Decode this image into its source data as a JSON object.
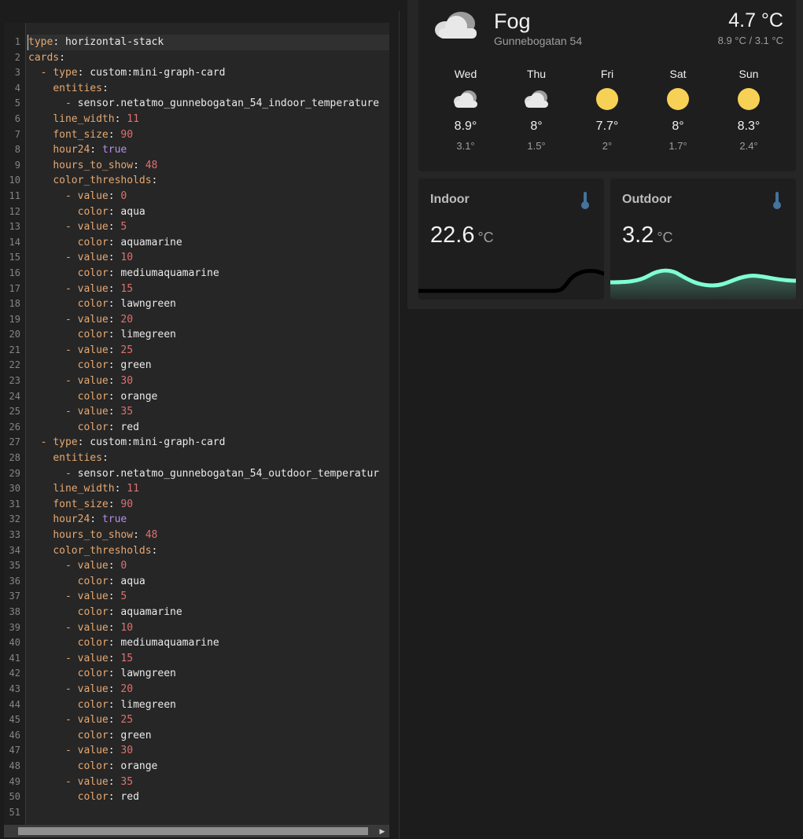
{
  "editor": {
    "lines": [
      [
        [
          "k",
          "type"
        ],
        [
          "s",
          ": "
        ],
        [
          "s",
          "horizontal-stack"
        ]
      ],
      [
        [
          "k",
          "cards"
        ],
        [
          "s",
          ":"
        ]
      ],
      [
        [
          "s",
          "  "
        ],
        [
          "d",
          "- "
        ],
        [
          "k",
          "type"
        ],
        [
          "s",
          ": custom:mini-graph-card"
        ]
      ],
      [
        [
          "s",
          "    "
        ],
        [
          "k",
          "entities"
        ],
        [
          "s",
          ":"
        ]
      ],
      [
        [
          "s",
          "      "
        ],
        [
          "d",
          "- "
        ],
        [
          "s",
          "sensor.netatmo_gunnebogatan_54_indoor_temperature"
        ]
      ],
      [
        [
          "s",
          "    "
        ],
        [
          "k",
          "line_width"
        ],
        [
          "s",
          ": "
        ],
        [
          "n",
          "11"
        ]
      ],
      [
        [
          "s",
          "    "
        ],
        [
          "k",
          "font_size"
        ],
        [
          "s",
          ": "
        ],
        [
          "n",
          "90"
        ]
      ],
      [
        [
          "s",
          "    "
        ],
        [
          "k",
          "hour24"
        ],
        [
          "s",
          ": "
        ],
        [
          "b",
          "true"
        ]
      ],
      [
        [
          "s",
          "    "
        ],
        [
          "k",
          "hours_to_show"
        ],
        [
          "s",
          ": "
        ],
        [
          "n",
          "48"
        ]
      ],
      [
        [
          "s",
          "    "
        ],
        [
          "k",
          "color_thresholds"
        ],
        [
          "s",
          ":"
        ]
      ],
      [
        [
          "s",
          "      "
        ],
        [
          "d",
          "- "
        ],
        [
          "k",
          "value"
        ],
        [
          "s",
          ": "
        ],
        [
          "n",
          "0"
        ]
      ],
      [
        [
          "s",
          "        "
        ],
        [
          "k",
          "color"
        ],
        [
          "s",
          ": aqua"
        ]
      ],
      [
        [
          "s",
          "      "
        ],
        [
          "d",
          "- "
        ],
        [
          "k",
          "value"
        ],
        [
          "s",
          ": "
        ],
        [
          "n",
          "5"
        ]
      ],
      [
        [
          "s",
          "        "
        ],
        [
          "k",
          "color"
        ],
        [
          "s",
          ": aquamarine"
        ]
      ],
      [
        [
          "s",
          "      "
        ],
        [
          "d",
          "- "
        ],
        [
          "k",
          "value"
        ],
        [
          "s",
          ": "
        ],
        [
          "n",
          "10"
        ]
      ],
      [
        [
          "s",
          "        "
        ],
        [
          "k",
          "color"
        ],
        [
          "s",
          ": mediumaquamarine"
        ]
      ],
      [
        [
          "s",
          "      "
        ],
        [
          "d",
          "- "
        ],
        [
          "k",
          "value"
        ],
        [
          "s",
          ": "
        ],
        [
          "n",
          "15"
        ]
      ],
      [
        [
          "s",
          "        "
        ],
        [
          "k",
          "color"
        ],
        [
          "s",
          ": lawngreen"
        ]
      ],
      [
        [
          "s",
          "      "
        ],
        [
          "d",
          "- "
        ],
        [
          "k",
          "value"
        ],
        [
          "s",
          ": "
        ],
        [
          "n",
          "20"
        ]
      ],
      [
        [
          "s",
          "        "
        ],
        [
          "k",
          "color"
        ],
        [
          "s",
          ": limegreen"
        ]
      ],
      [
        [
          "s",
          "      "
        ],
        [
          "d",
          "- "
        ],
        [
          "k",
          "value"
        ],
        [
          "s",
          ": "
        ],
        [
          "n",
          "25"
        ]
      ],
      [
        [
          "s",
          "        "
        ],
        [
          "k",
          "color"
        ],
        [
          "s",
          ": green"
        ]
      ],
      [
        [
          "s",
          "      "
        ],
        [
          "d",
          "- "
        ],
        [
          "k",
          "value"
        ],
        [
          "s",
          ": "
        ],
        [
          "n",
          "30"
        ]
      ],
      [
        [
          "s",
          "        "
        ],
        [
          "k",
          "color"
        ],
        [
          "s",
          ": orange"
        ]
      ],
      [
        [
          "s",
          "      "
        ],
        [
          "d",
          "- "
        ],
        [
          "k",
          "value"
        ],
        [
          "s",
          ": "
        ],
        [
          "n",
          "35"
        ]
      ],
      [
        [
          "s",
          "        "
        ],
        [
          "k",
          "color"
        ],
        [
          "s",
          ": red"
        ]
      ],
      [
        [
          "s",
          "  "
        ],
        [
          "d",
          "- "
        ],
        [
          "k",
          "type"
        ],
        [
          "s",
          ": custom:mini-graph-card"
        ]
      ],
      [
        [
          "s",
          "    "
        ],
        [
          "k",
          "entities"
        ],
        [
          "s",
          ":"
        ]
      ],
      [
        [
          "s",
          "      "
        ],
        [
          "d",
          "- "
        ],
        [
          "s",
          "sensor.netatmo_gunnebogatan_54_outdoor_temperatur"
        ]
      ],
      [
        [
          "s",
          "    "
        ],
        [
          "k",
          "line_width"
        ],
        [
          "s",
          ": "
        ],
        [
          "n",
          "11"
        ]
      ],
      [
        [
          "s",
          "    "
        ],
        [
          "k",
          "font_size"
        ],
        [
          "s",
          ": "
        ],
        [
          "n",
          "90"
        ]
      ],
      [
        [
          "s",
          "    "
        ],
        [
          "k",
          "hour24"
        ],
        [
          "s",
          ": "
        ],
        [
          "b",
          "true"
        ]
      ],
      [
        [
          "s",
          "    "
        ],
        [
          "k",
          "hours_to_show"
        ],
        [
          "s",
          ": "
        ],
        [
          "n",
          "48"
        ]
      ],
      [
        [
          "s",
          "    "
        ],
        [
          "k",
          "color_thresholds"
        ],
        [
          "s",
          ":"
        ]
      ],
      [
        [
          "s",
          "      "
        ],
        [
          "d",
          "- "
        ],
        [
          "k",
          "value"
        ],
        [
          "s",
          ": "
        ],
        [
          "n",
          "0"
        ]
      ],
      [
        [
          "s",
          "        "
        ],
        [
          "k",
          "color"
        ],
        [
          "s",
          ": aqua"
        ]
      ],
      [
        [
          "s",
          "      "
        ],
        [
          "d",
          "- "
        ],
        [
          "k",
          "value"
        ],
        [
          "s",
          ": "
        ],
        [
          "n",
          "5"
        ]
      ],
      [
        [
          "s",
          "        "
        ],
        [
          "k",
          "color"
        ],
        [
          "s",
          ": aquamarine"
        ]
      ],
      [
        [
          "s",
          "      "
        ],
        [
          "d",
          "- "
        ],
        [
          "k",
          "value"
        ],
        [
          "s",
          ": "
        ],
        [
          "n",
          "10"
        ]
      ],
      [
        [
          "s",
          "        "
        ],
        [
          "k",
          "color"
        ],
        [
          "s",
          ": mediumaquamarine"
        ]
      ],
      [
        [
          "s",
          "      "
        ],
        [
          "d",
          "- "
        ],
        [
          "k",
          "value"
        ],
        [
          "s",
          ": "
        ],
        [
          "n",
          "15"
        ]
      ],
      [
        [
          "s",
          "        "
        ],
        [
          "k",
          "color"
        ],
        [
          "s",
          ": lawngreen"
        ]
      ],
      [
        [
          "s",
          "      "
        ],
        [
          "d",
          "- "
        ],
        [
          "k",
          "value"
        ],
        [
          "s",
          ": "
        ],
        [
          "n",
          "20"
        ]
      ],
      [
        [
          "s",
          "        "
        ],
        [
          "k",
          "color"
        ],
        [
          "s",
          ": limegreen"
        ]
      ],
      [
        [
          "s",
          "      "
        ],
        [
          "d",
          "- "
        ],
        [
          "k",
          "value"
        ],
        [
          "s",
          ": "
        ],
        [
          "n",
          "25"
        ]
      ],
      [
        [
          "s",
          "        "
        ],
        [
          "k",
          "color"
        ],
        [
          "s",
          ": green"
        ]
      ],
      [
        [
          "s",
          "      "
        ],
        [
          "d",
          "- "
        ],
        [
          "k",
          "value"
        ],
        [
          "s",
          ": "
        ],
        [
          "n",
          "30"
        ]
      ],
      [
        [
          "s",
          "        "
        ],
        [
          "k",
          "color"
        ],
        [
          "s",
          ": orange"
        ]
      ],
      [
        [
          "s",
          "      "
        ],
        [
          "d",
          "- "
        ],
        [
          "k",
          "value"
        ],
        [
          "s",
          ": "
        ],
        [
          "n",
          "35"
        ]
      ],
      [
        [
          "s",
          "        "
        ],
        [
          "k",
          "color"
        ],
        [
          "s",
          ": red"
        ]
      ],
      []
    ],
    "scroll_right_arrow": "▶"
  },
  "weather": {
    "condition": "Fog",
    "location": "Gunnebogatan 54",
    "temperature": "4.7 °C",
    "range": "8.9 °C / 3.1 °C",
    "condition_icon": "cloud-icon",
    "forecast": [
      {
        "day": "Wed",
        "icon": "cloudy",
        "high": "8.9°",
        "low": "3.1°"
      },
      {
        "day": "Thu",
        "icon": "cloudy",
        "high": "8°",
        "low": "1.5°"
      },
      {
        "day": "Fri",
        "icon": "sunny",
        "high": "7.7°",
        "low": "2°"
      },
      {
        "day": "Sat",
        "icon": "sunny",
        "high": "8°",
        "low": "1.7°"
      },
      {
        "day": "Sun",
        "icon": "sunny",
        "high": "8.3°",
        "low": "2.4°"
      }
    ]
  },
  "sensors": {
    "indoor": {
      "name": "Indoor",
      "value": "22.6",
      "unit": "°C",
      "icon": "thermometer-icon",
      "line_color": "#000000"
    },
    "outdoor": {
      "name": "Outdoor",
      "value": "3.2",
      "unit": "°C",
      "icon": "thermometer-icon",
      "line_color": "#7fffd4"
    }
  },
  "colors": {
    "sun": "#f6d155",
    "thermometer": "#44739e",
    "cloud": "#e8e8e8"
  }
}
